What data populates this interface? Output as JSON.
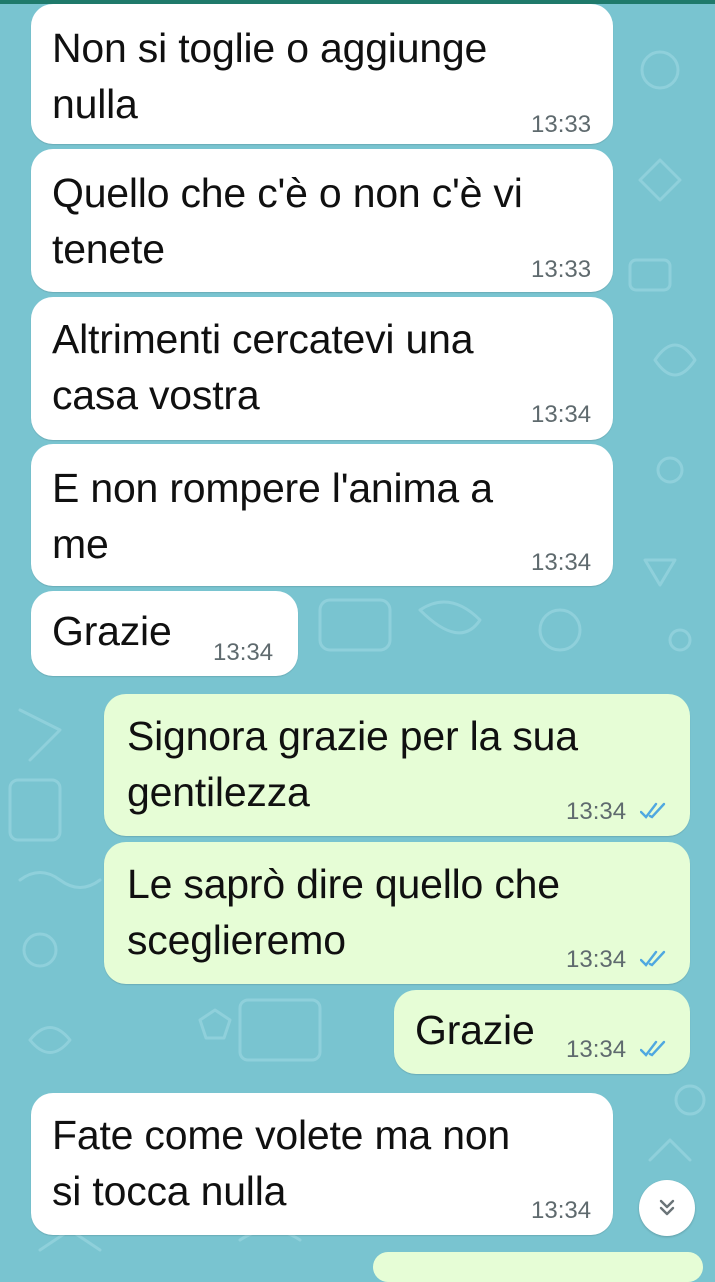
{
  "colors": {
    "wallpaper": "#79c4d0",
    "incoming_bubble": "#ffffff",
    "outgoing_bubble": "#e6fdd6",
    "read_ticks": "#4fa8e0"
  },
  "messages": [
    {
      "direction": "incoming",
      "text": "Non si toglie o aggiunge\nnulla",
      "time": "13:33"
    },
    {
      "direction": "incoming",
      "text": "Quello che c'è o non c'è vi\ntenete",
      "time": "13:33"
    },
    {
      "direction": "incoming",
      "text": "Altrimenti cercatevi una\ncasa vostra",
      "time": "13:34"
    },
    {
      "direction": "incoming",
      "text": "E non rompere l'anima a\nme",
      "time": "13:34"
    },
    {
      "direction": "incoming",
      "text": "Grazie",
      "time": "13:34"
    },
    {
      "direction": "outgoing",
      "text": "Signora grazie per la sua\ngentilezza",
      "time": "13:34",
      "status": "read"
    },
    {
      "direction": "outgoing",
      "text": "Le saprò dire quello che\nsceglieremo",
      "time": "13:34",
      "status": "read"
    },
    {
      "direction": "outgoing",
      "text": "Grazie",
      "time": "13:34",
      "status": "read"
    },
    {
      "direction": "incoming",
      "text": "Fate come volete ma non\nsi tocca nulla",
      "time": "13:34"
    }
  ],
  "scroll_button": {
    "icon": "double-chevron-down-icon"
  }
}
